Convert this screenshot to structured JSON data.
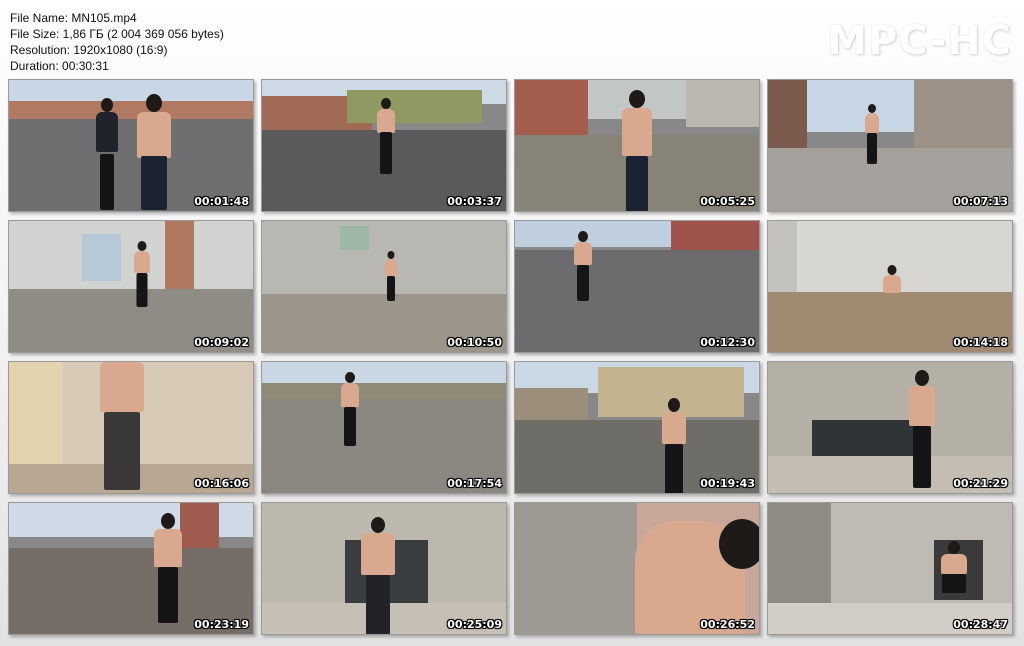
{
  "info": {
    "file_name": "File Name: MN105.mp4",
    "file_size": "File Size: 1,86 ГБ (2 004 369 056 bytes)",
    "resolution": "Resolution: 1920x1080 (16:9)",
    "duration": "Duration: 00:30:31"
  },
  "logo": "MPC-HC",
  "thumbnails": [
    {
      "time": "00:01:48"
    },
    {
      "time": "00:03:37"
    },
    {
      "time": "00:05:25"
    },
    {
      "time": "00:07:13"
    },
    {
      "time": "00:09:02"
    },
    {
      "time": "00:10:50"
    },
    {
      "time": "00:12:30"
    },
    {
      "time": "00:14:18"
    },
    {
      "time": "00:16:06"
    },
    {
      "time": "00:17:54"
    },
    {
      "time": "00:19:43"
    },
    {
      "time": "00:21:29"
    },
    {
      "time": "00:23:19"
    },
    {
      "time": "00:25:09"
    },
    {
      "time": "00:26:52"
    },
    {
      "time": "00:28:47"
    }
  ]
}
